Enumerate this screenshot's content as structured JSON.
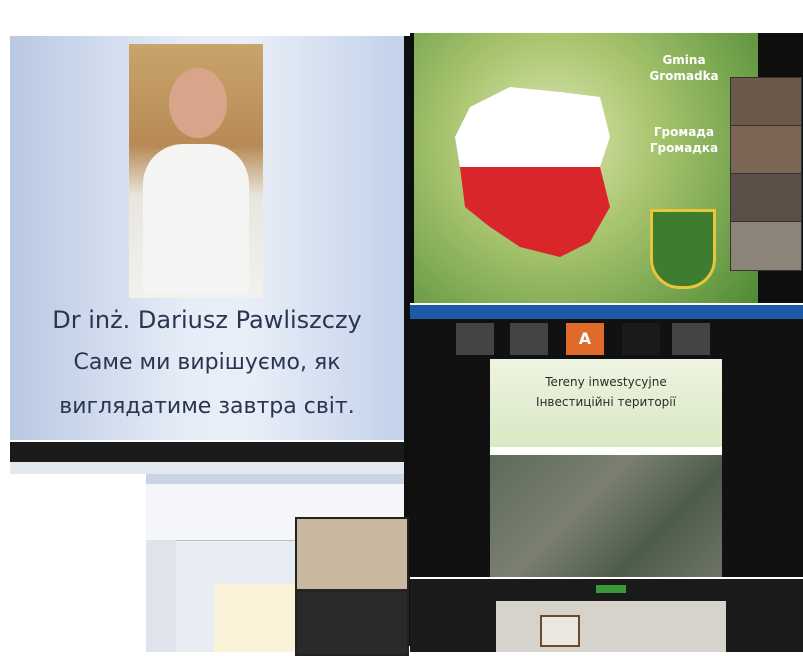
{
  "slide_title": {
    "name_line": "Dr inż. Dariusz Pawliszczy",
    "quote_line1": "Саме ми вирішуємо, як",
    "quote_line2": "виглядатиме завтра світ."
  },
  "map_slide": {
    "title_pl_1": "Gmina",
    "title_pl_2": "Gromadka",
    "title_ua_1": "Громада",
    "title_ua_2": "Громадка"
  },
  "meeting_slide": {
    "title_pl": "Tereny inwestycyjne",
    "title_ua": "Інвестиційні території",
    "participant_letter": "A"
  },
  "colors": {
    "poland_white": "#ffffff",
    "poland_red": "#d8262b",
    "zoom_blue": "#1e5aa8",
    "slide_green": "#4f8a34"
  }
}
